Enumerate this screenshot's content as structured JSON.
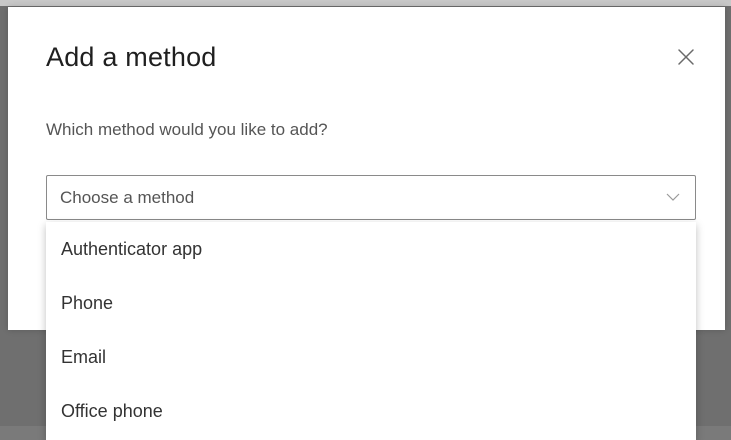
{
  "dialog": {
    "title": "Add a method",
    "close_icon": "close-icon",
    "prompt": "Which method would you like to add?"
  },
  "select": {
    "selected_value": "Choose a method",
    "chevron_icon": "chevron-down-icon",
    "options": [
      "Authenticator app",
      "Phone",
      "Email",
      "Office phone"
    ]
  },
  "colors": {
    "overlay": "#6f6f6f",
    "dialog_background": "#ffffff",
    "text_primary": "#1f1f1f",
    "text_secondary": "#555555",
    "select_border": "#8a8a8a"
  }
}
